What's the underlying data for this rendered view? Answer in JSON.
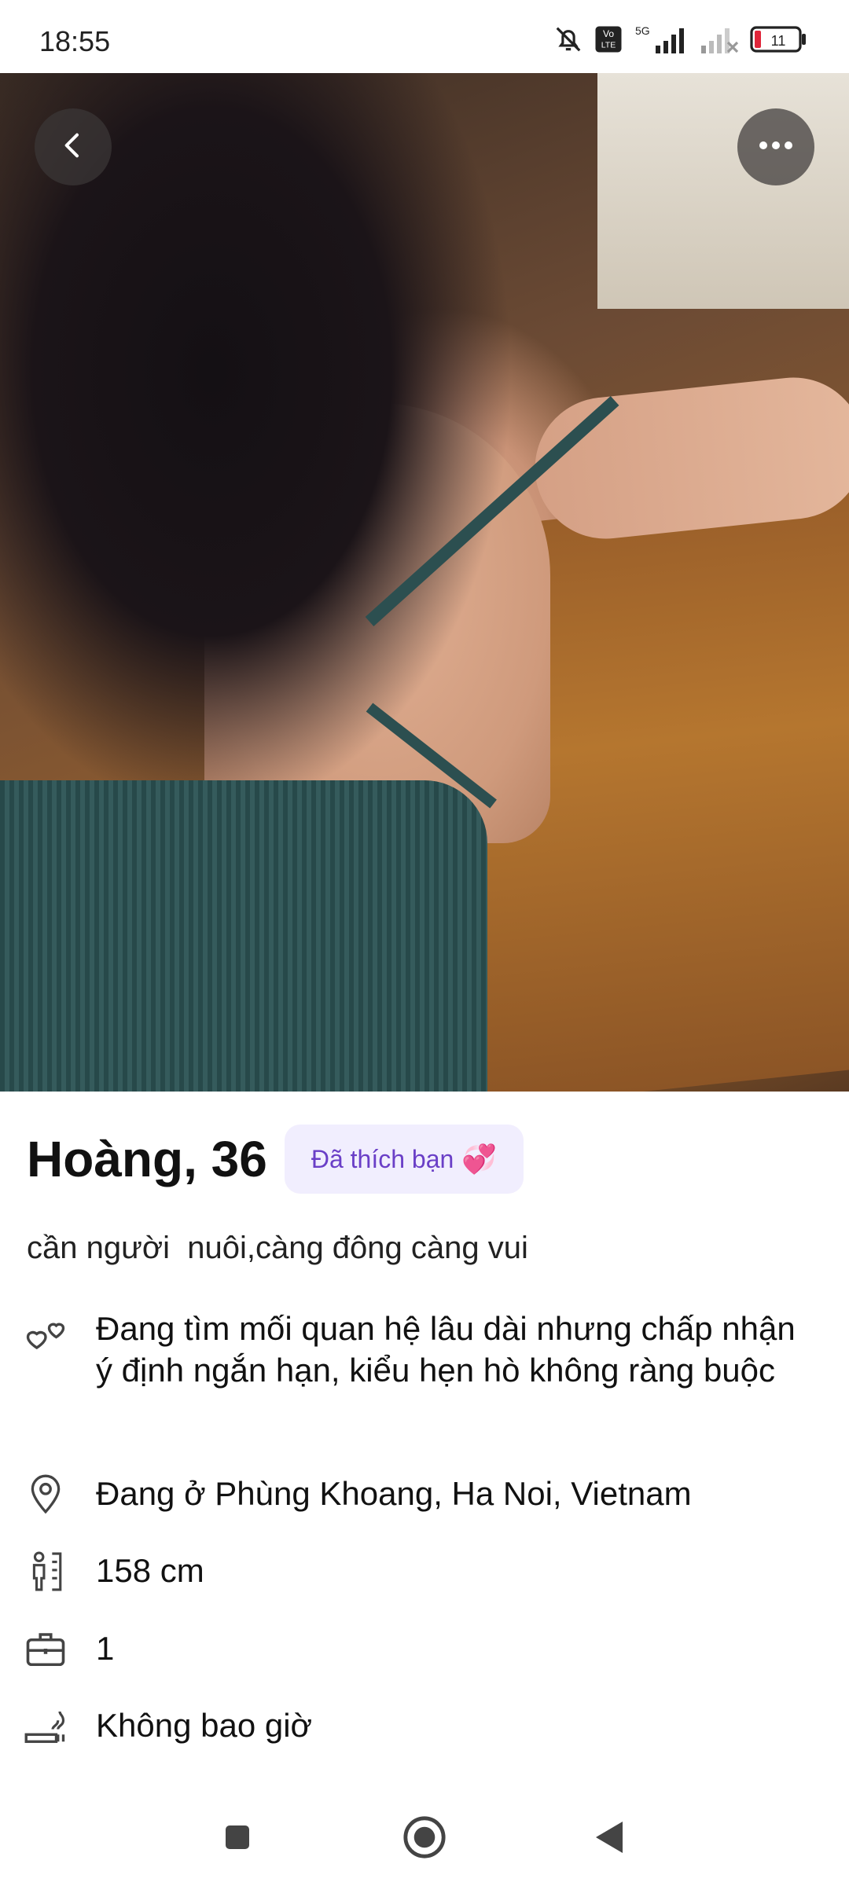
{
  "status_bar": {
    "time": "18:55",
    "icons": [
      "bell-muted-icon",
      "volte-icon",
      "signal-5g-icon",
      "signal-weak-icon",
      "battery-icon"
    ],
    "network_label": "5G",
    "volte_label": "Vo LTE",
    "battery_level": "11"
  },
  "photo": {
    "back_icon": "chevron-left-icon",
    "more_icon": "more-horizontal-icon"
  },
  "profile": {
    "name_age": "Hoàng, 36",
    "liked_badge": "Đã thích bạn",
    "liked_emoji": "💞",
    "bio": "cần người  nuôi,càng đông càng vui",
    "details": [
      {
        "icon": "hearts-icon",
        "text": "Đang tìm mối quan hệ lâu dài nhưng chấp nhận ý định ngắn hạn, kiểu hẹn hò không ràng buộc"
      },
      {
        "icon": "location-pin-icon",
        "text": "Đang ở Phùng Khoang, Ha Noi, Vietnam"
      },
      {
        "icon": "height-icon",
        "text": "158 cm"
      },
      {
        "icon": "briefcase-icon",
        "text": "1"
      },
      {
        "icon": "smoking-icon",
        "text": "Không bao giờ"
      }
    ]
  },
  "nav": {
    "icons": [
      "recent-apps-icon",
      "home-icon",
      "back-icon"
    ]
  },
  "colors": {
    "badge_bg": "#f1eefe",
    "badge_text": "#6a3fc7",
    "overlay_button": "#3c3737"
  }
}
